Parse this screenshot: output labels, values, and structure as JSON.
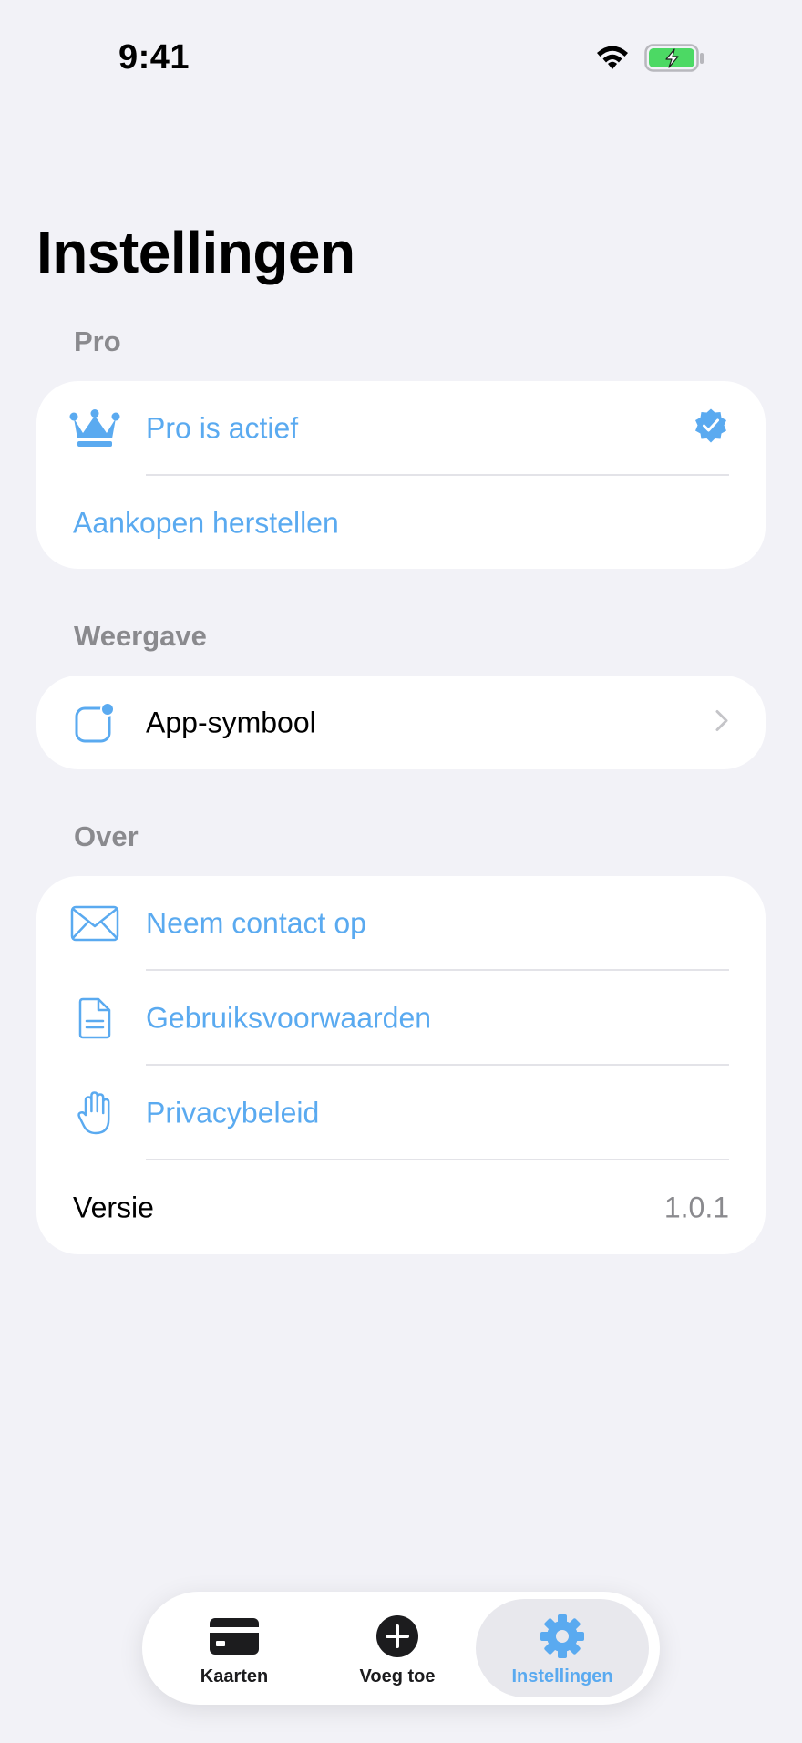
{
  "status_bar": {
    "time": "9:41",
    "wifi_icon": "wifi-icon",
    "battery_icon": "battery-charging-icon"
  },
  "page": {
    "title": "Instellingen"
  },
  "colors": {
    "accent": "#5aaaf0",
    "background": "#f2f2f7",
    "secondary_text": "#8a8a8e",
    "battery_green": "#4cd964"
  },
  "sections": {
    "pro": {
      "header": "Pro",
      "rows": [
        {
          "label": "Pro is actief",
          "icon": "crown-icon",
          "trailing_icon": "verified-checkmark-icon"
        },
        {
          "label": "Aankopen herstellen"
        }
      ]
    },
    "display": {
      "header": "Weergave",
      "rows": [
        {
          "label": "App-symbool",
          "icon": "app-icon-badge-icon",
          "trailing_icon": "chevron-right-icon"
        }
      ]
    },
    "about": {
      "header": "Over",
      "rows": [
        {
          "label": "Neem contact op",
          "icon": "envelope-icon"
        },
        {
          "label": "Gebruiksvoorwaarden",
          "icon": "document-icon"
        },
        {
          "label": "Privacybeleid",
          "icon": "hand-icon"
        },
        {
          "label": "Versie",
          "value": "1.0.1"
        }
      ]
    }
  },
  "tab_bar": {
    "active": "Instellingen",
    "tabs": [
      {
        "label": "Kaarten",
        "icon": "card-icon"
      },
      {
        "label": "Voeg toe",
        "icon": "plus-circle-icon"
      },
      {
        "label": "Instellingen",
        "icon": "gear-icon"
      }
    ]
  }
}
